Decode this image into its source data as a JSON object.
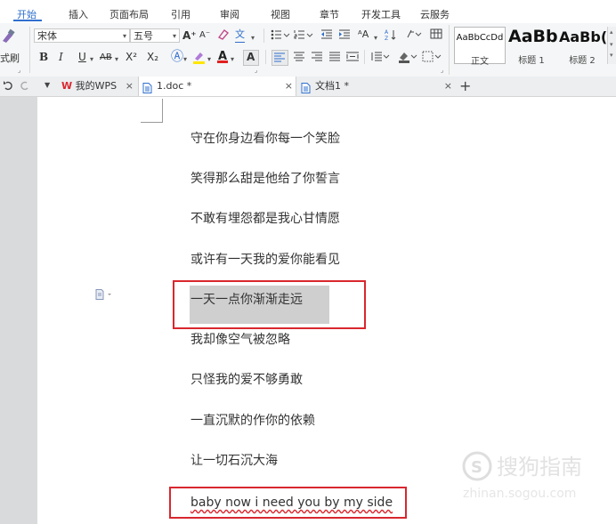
{
  "menu": {
    "tabs": [
      "开始",
      "插入",
      "页面布局",
      "引用",
      "审阅",
      "视图",
      "章节",
      "开发工具",
      "云服务"
    ]
  },
  "ribbon": {
    "left_partial_label": "式刷",
    "font_name": "宋体",
    "font_size": "五号",
    "bold": "B",
    "italic": "I",
    "underline": "U",
    "strike": "AB",
    "superscript": "X²",
    "subscript": "X₂",
    "grow_font": "A⁺",
    "shrink_font": "A⁻",
    "pinyin": "文",
    "styles": [
      {
        "sample": "AaBbCcDd",
        "label": "正文"
      },
      {
        "sample": "AaBb",
        "label": "标题 1"
      },
      {
        "sample": "AaBb(",
        "label": "标题 2"
      }
    ]
  },
  "tabbar": {
    "tabs": [
      {
        "label": "我的WPS"
      },
      {
        "label": "1.doc *"
      },
      {
        "label": "文档1 *"
      }
    ],
    "new_tab": "+"
  },
  "document": {
    "lines": [
      "守在你身边看你每一个笑脸",
      "笑得那么甜是他给了你誓言",
      "不敢有埋怨都是我心甘情愿",
      "或许有一天我的爱你能看见",
      "一天一点你渐渐走远",
      "我却像空气被忽略",
      "只怪我的爱不够勇敢",
      "一直沉默的作你的依赖",
      "让一切石沉大海",
      "baby now i need you by my side"
    ]
  },
  "colors": {
    "accent": "#2f6fce",
    "highlight_box": "#d9272e",
    "selection": "#cfcfcf",
    "wps_logo": "#d9272e"
  }
}
